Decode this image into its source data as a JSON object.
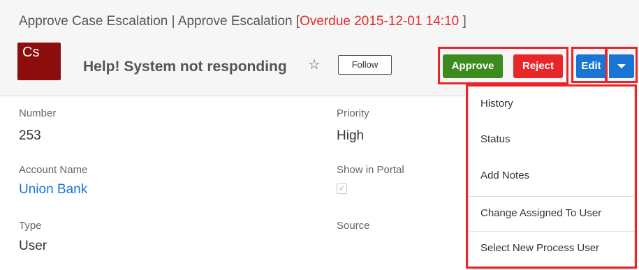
{
  "header": {
    "process_name": "Approve Case Escalation",
    "separator": "|",
    "activity_name": "Approve Escalation",
    "bracket_open": "[",
    "overdue_text": "Overdue 2015-12-01 14:10",
    "bracket_close": "]"
  },
  "record": {
    "avatar_text": "Cs",
    "name": "Help! System not responding",
    "star_glyph": "☆",
    "follow_label": "Follow"
  },
  "actions": {
    "approve_label": "Approve",
    "reject_label": "Reject",
    "edit_label": "Edit"
  },
  "fields": {
    "number_label": "Number",
    "number_value": "253",
    "priority_label": "Priority",
    "priority_value": "High",
    "account_label": "Account Name",
    "account_value": "Union Bank",
    "portal_label": "Show in Portal",
    "portal_check": "✓",
    "type_label": "Type",
    "type_value": "User",
    "source_label": "Source"
  },
  "dropdown": {
    "items": [
      "History",
      "Status",
      "Add Notes",
      "Change Assigned To User",
      "Select New Process User"
    ]
  },
  "colors": {
    "highlight": "#e8262a",
    "approve": "#3b8b1f",
    "reject": "#e8262a",
    "edit": "#1a74d4",
    "avatar": "#8b0d0d",
    "link": "#1a74d4"
  }
}
